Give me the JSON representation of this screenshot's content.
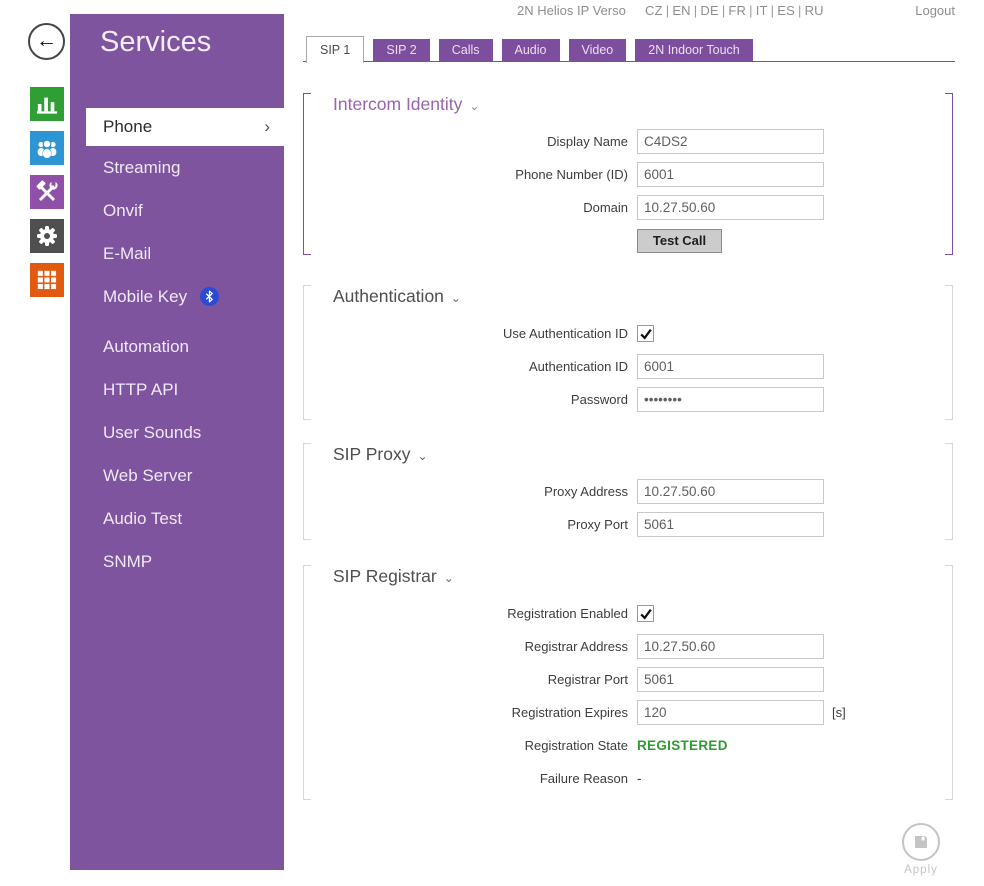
{
  "topbar": {
    "title": "2N Helios IP Verso",
    "languages": [
      "CZ",
      "EN",
      "DE",
      "FR",
      "IT",
      "ES",
      "RU"
    ],
    "separator": "|",
    "logout_label": "Logout"
  },
  "icon_rail": {
    "icons": [
      "status-icon",
      "directory-icon",
      "hardware-icon",
      "services-icon",
      "system-icon"
    ]
  },
  "sidebar": {
    "title": "Services",
    "items": [
      {
        "label": "Phone",
        "active": true
      },
      {
        "label": "Streaming"
      },
      {
        "label": "Onvif"
      },
      {
        "label": "E-Mail"
      },
      {
        "label": "Mobile Key",
        "bluetooth_badge": true
      },
      {
        "label": "Automation"
      },
      {
        "label": "HTTP API"
      },
      {
        "label": "User Sounds"
      },
      {
        "label": "Web Server"
      },
      {
        "label": "Audio Test"
      },
      {
        "label": "SNMP"
      }
    ]
  },
  "tabs": [
    {
      "label": "SIP 1",
      "active": true
    },
    {
      "label": "SIP 2"
    },
    {
      "label": "Calls"
    },
    {
      "label": "Audio"
    },
    {
      "label": "Video"
    },
    {
      "label": "2N Indoor Touch"
    }
  ],
  "sections": {
    "intercom_identity": {
      "title": "Intercom Identity",
      "fields": {
        "display_name": {
          "label": "Display Name",
          "value": "C4DS2"
        },
        "phone_number": {
          "label": "Phone Number (ID)",
          "value": "6001"
        },
        "domain": {
          "label": "Domain",
          "value": "10.27.50.60"
        }
      },
      "test_call_label": "Test Call"
    },
    "authentication": {
      "title": "Authentication",
      "fields": {
        "use_auth_id": {
          "label": "Use Authentication ID",
          "checked": true
        },
        "auth_id": {
          "label": "Authentication ID",
          "value": "6001"
        },
        "password": {
          "label": "Password",
          "value": "••••••••"
        }
      }
    },
    "sip_proxy": {
      "title": "SIP Proxy",
      "fields": {
        "proxy_address": {
          "label": "Proxy Address",
          "value": "10.27.50.60"
        },
        "proxy_port": {
          "label": "Proxy Port",
          "value": "5061"
        }
      }
    },
    "sip_registrar": {
      "title": "SIP Registrar",
      "fields": {
        "registration_enabled": {
          "label": "Registration Enabled",
          "checked": true
        },
        "registrar_address": {
          "label": "Registrar Address",
          "value": "10.27.50.60"
        },
        "registrar_port": {
          "label": "Registrar Port",
          "value": "5061"
        },
        "registration_expires": {
          "label": "Registration Expires",
          "value": "120",
          "unit": "[s]"
        },
        "registration_state": {
          "label": "Registration State",
          "value": "REGISTERED"
        },
        "failure_reason": {
          "label": "Failure Reason",
          "value": "-"
        }
      }
    }
  },
  "apply": {
    "label": "Apply"
  },
  "icons": {
    "chevron_down": "⌄",
    "chevron_right": "›",
    "back_arrow": "←"
  },
  "colors": {
    "sidebar_purple": "#7F549E",
    "tab_purple": "#7D4D9E",
    "heading_purple": "#9A63AC",
    "status_green": "#2E9B2E",
    "icon_status_green": "#2F9E35",
    "icon_directory_blue": "#2D96D2",
    "icon_hardware_purple": "#9150A8",
    "icon_services_gray": "#4F4F4F",
    "icon_system_orange": "#E25A0F"
  }
}
